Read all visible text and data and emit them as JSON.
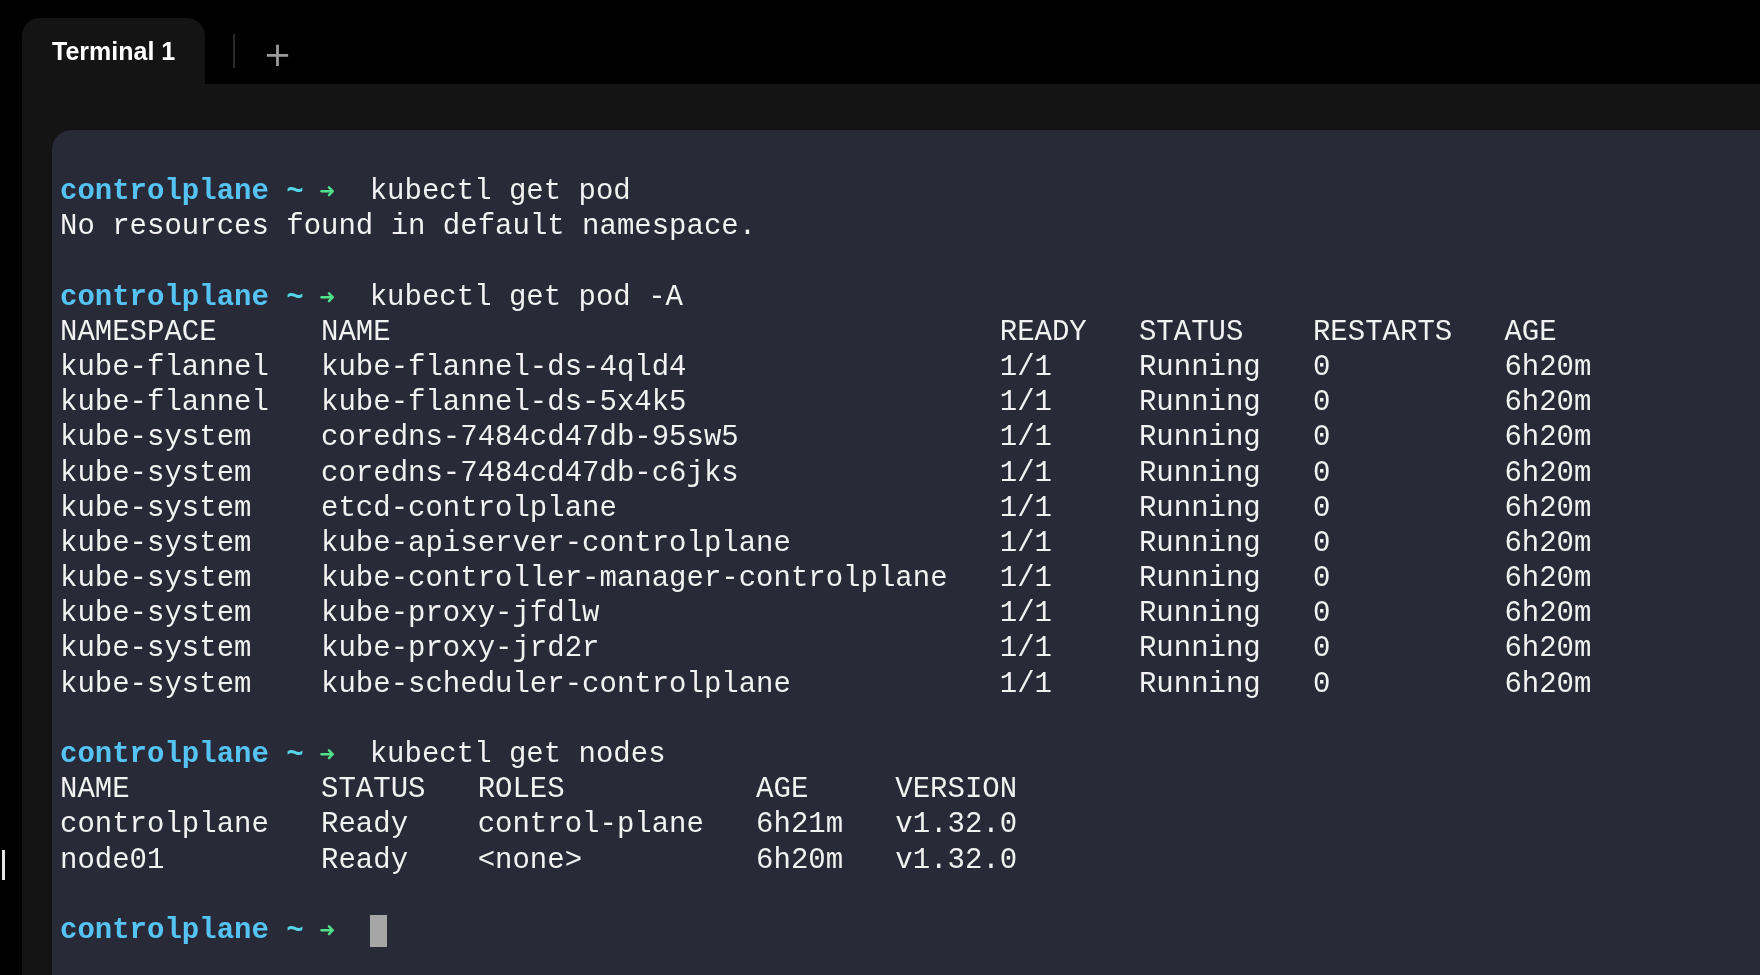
{
  "tabs": [
    {
      "label": "Terminal 1",
      "selected": true
    }
  ],
  "new_tab_button": {
    "label": "+"
  },
  "terminal": {
    "blocks": [
      {
        "prompt": {
          "host": "controlplane",
          "dir": "~",
          "arrow": "➜"
        },
        "command": "kubectl get pod",
        "output": [
          {
            "kind": "text",
            "text": "No resources found in default namespace."
          }
        ]
      },
      {
        "prompt": {
          "host": "controlplane",
          "dir": "~",
          "arrow": "➜"
        },
        "command": "kubectl get pod -A",
        "output": [
          {
            "kind": "table",
            "columns": [
              "NAMESPACE",
              "NAME",
              "READY",
              "STATUS",
              "RESTARTS",
              "AGE"
            ],
            "rows": [
              [
                "kube-flannel",
                "kube-flannel-ds-4qld4",
                "1/1",
                "Running",
                "0",
                "6h20m"
              ],
              [
                "kube-flannel",
                "kube-flannel-ds-5x4k5",
                "1/1",
                "Running",
                "0",
                "6h20m"
              ],
              [
                "kube-system",
                "coredns-7484cd47db-95sw5",
                "1/1",
                "Running",
                "0",
                "6h20m"
              ],
              [
                "kube-system",
                "coredns-7484cd47db-c6jks",
                "1/1",
                "Running",
                "0",
                "6h20m"
              ],
              [
                "kube-system",
                "etcd-controlplane",
                "1/1",
                "Running",
                "0",
                "6h20m"
              ],
              [
                "kube-system",
                "kube-apiserver-controlplane",
                "1/1",
                "Running",
                "0",
                "6h20m"
              ],
              [
                "kube-system",
                "kube-controller-manager-controlplane",
                "1/1",
                "Running",
                "0",
                "6h20m"
              ],
              [
                "kube-system",
                "kube-proxy-jfdlw",
                "1/1",
                "Running",
                "0",
                "6h20m"
              ],
              [
                "kube-system",
                "kube-proxy-jrd2r",
                "1/1",
                "Running",
                "0",
                "6h20m"
              ],
              [
                "kube-system",
                "kube-scheduler-controlplane",
                "1/1",
                "Running",
                "0",
                "6h20m"
              ]
            ]
          }
        ]
      },
      {
        "prompt": {
          "host": "controlplane",
          "dir": "~",
          "arrow": "➜"
        },
        "command": "kubectl get nodes",
        "output": [
          {
            "kind": "table",
            "columns": [
              "NAME",
              "STATUS",
              "ROLES",
              "AGE",
              "VERSION"
            ],
            "rows": [
              [
                "controlplane",
                "Ready",
                "control-plane",
                "6h21m",
                "v1.32.0"
              ],
              [
                "node01",
                "Ready",
                "<none>",
                "6h20m",
                "v1.32.0"
              ]
            ]
          }
        ]
      },
      {
        "prompt": {
          "host": "controlplane",
          "dir": "~",
          "arrow": "➜"
        },
        "cursor": true
      }
    ]
  }
}
